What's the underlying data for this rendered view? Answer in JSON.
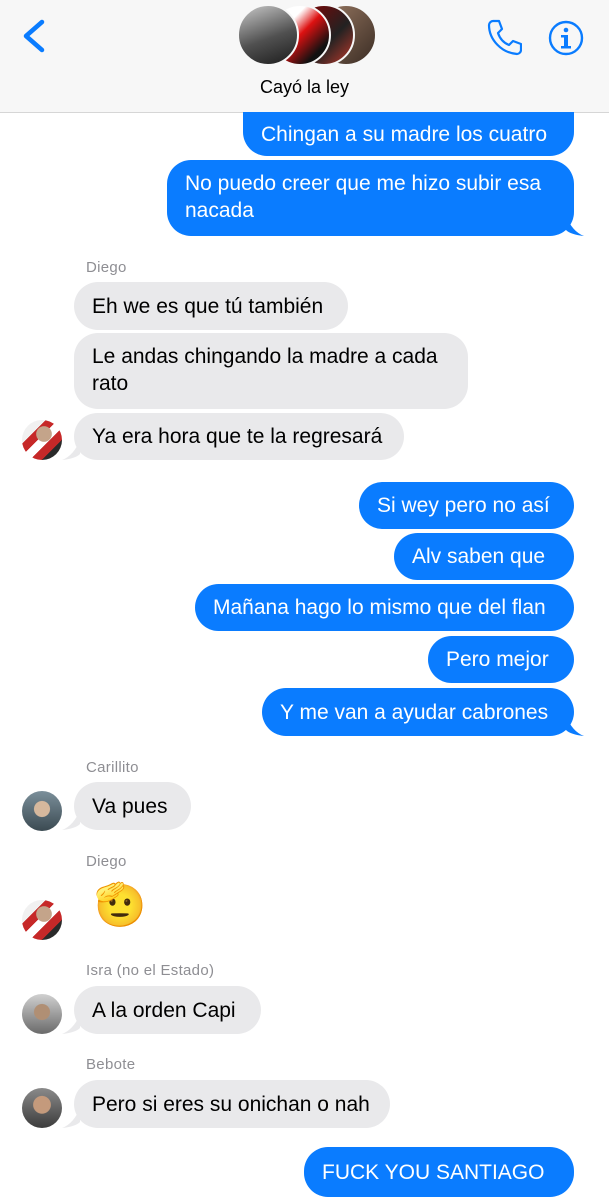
{
  "header": {
    "title": "Cayó la ley",
    "back_icon": "chevron-left-icon",
    "call_icon": "phone-icon",
    "info_icon": "info-icon",
    "accent_color": "#0a7cff"
  },
  "messages": [
    {
      "dir": "out",
      "text": "Chingan a su madre los cuatro"
    },
    {
      "dir": "out",
      "text": "No puedo creer que me hizo subir esa nacada"
    },
    {
      "dir": "in",
      "sender": "Diego",
      "text": "Eh we es que tú también"
    },
    {
      "dir": "in",
      "text": "Le andas chingando la madre a cada rato"
    },
    {
      "dir": "in",
      "text": "Ya era hora que te la regresará"
    },
    {
      "dir": "out",
      "text": "Si wey pero no así"
    },
    {
      "dir": "out",
      "text": "Alv saben que"
    },
    {
      "dir": "out",
      "text": "Mañana hago lo mismo que del flan"
    },
    {
      "dir": "out",
      "text": "Pero mejor"
    },
    {
      "dir": "out",
      "text": "Y me van a ayudar cabrones"
    },
    {
      "dir": "in",
      "sender": "Carillito",
      "text": "Va pues"
    },
    {
      "dir": "in",
      "sender": "Diego",
      "text": "🫡",
      "emoji": "saluting-face"
    },
    {
      "dir": "in",
      "sender": "Isra (no el Estado)",
      "text": "A la orden Capi"
    },
    {
      "dir": "in",
      "sender": "Bebote",
      "text": "Pero si eres su onichan o nah"
    },
    {
      "dir": "out",
      "text": "FUCK YOU SANTIAGO"
    }
  ]
}
